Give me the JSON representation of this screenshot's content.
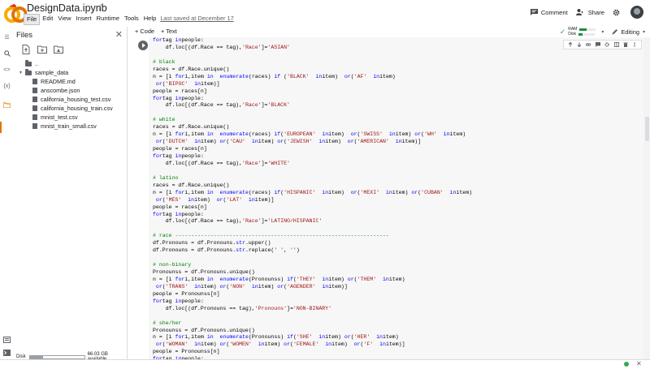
{
  "header": {
    "title": "DesignData.ipynb",
    "menu": [
      "File",
      "Edit",
      "View",
      "Insert",
      "Runtime",
      "Tools",
      "Help"
    ],
    "active_menu": "File",
    "last_saved": "Last saved at December 17",
    "comment_label": "Comment",
    "share_label": "Share"
  },
  "files_panel": {
    "title": "Files",
    "tree": [
      {
        "name": "..",
        "type": "folder",
        "indent": 0,
        "caret": ""
      },
      {
        "name": "sample_data",
        "type": "folder",
        "indent": 0,
        "caret": "▾"
      },
      {
        "name": "README.md",
        "type": "file",
        "indent": 1
      },
      {
        "name": "anscombe.json",
        "type": "file",
        "indent": 1
      },
      {
        "name": "california_housing_test.csv",
        "type": "file",
        "indent": 1
      },
      {
        "name": "california_housing_train.csv",
        "type": "file",
        "indent": 1
      },
      {
        "name": "mnist_test.csv",
        "type": "file",
        "indent": 1
      },
      {
        "name": "mnist_train_small.csv",
        "type": "file",
        "indent": 1
      }
    ],
    "disk_label": "Disk",
    "disk_available": "66.03 GB available",
    "disk_used_fraction": 0.24
  },
  "toolbar": {
    "add_code": "+ Code",
    "add_text": "+ Text",
    "ram_label": "RAM",
    "disk_label": "Disk",
    "ram_fraction": 0.45,
    "disk_fraction": 0.25,
    "editing_label": "Editing"
  },
  "code_lines": [
    [
      [
        "kw",
        "for"
      ],
      [
        "",
        "tag "
      ],
      [
        "kw",
        "in"
      ],
      [
        "",
        "people:"
      ]
    ],
    [
      [
        "",
        "    df.loc[(df.Race == tag),"
      ],
      [
        "st",
        "'Race'"
      ],
      [
        "",
        "]="
      ],
      [
        "st",
        "'ASIAN'"
      ]
    ],
    [
      [
        "",
        ""
      ]
    ],
    [
      [
        "cm",
        "# black"
      ]
    ],
    [
      [
        "",
        "races = df.Race.unique()"
      ]
    ],
    [
      [
        "",
        "n = [i "
      ],
      [
        "kw",
        "for"
      ],
      [
        "",
        "i,item "
      ],
      [
        "kw",
        "in"
      ],
      [
        "",
        ""
      ],
      [
        "kw",
        "enumerate"
      ],
      [
        "",
        "(races) "
      ],
      [
        "kw",
        "if"
      ],
      [
        "",
        ""
      ],
      [
        "",
        "("
      ],
      [
        "st",
        "'BLACK'"
      ],
      [
        "",
        ""
      ],
      [
        "kw",
        "in"
      ],
      [
        "",
        "item)  "
      ],
      [
        "kw",
        "or"
      ],
      [
        "",
        "("
      ],
      [
        "st",
        "'AF'"
      ],
      [
        "",
        ""
      ],
      [
        "kw",
        "in"
      ],
      [
        "",
        "item)"
      ]
    ],
    [
      [
        "",
        ""
      ],
      [
        "kw",
        "or"
      ],
      [
        "",
        "("
      ],
      [
        "st",
        "'BIPOC'"
      ],
      [
        "",
        ""
      ],
      [
        "kw",
        "in"
      ],
      [
        "",
        "item)]"
      ]
    ],
    [
      [
        "",
        "people = races[n]"
      ]
    ],
    [
      [
        "kw",
        "for"
      ],
      [
        "",
        "tag "
      ],
      [
        "kw",
        "in"
      ],
      [
        "",
        "people:"
      ]
    ],
    [
      [
        "",
        "    df.loc[(df.Race == tag),"
      ],
      [
        "st",
        "'Race'"
      ],
      [
        "",
        "]="
      ],
      [
        "st",
        "'BLACK'"
      ]
    ],
    [
      [
        "",
        ""
      ]
    ],
    [
      [
        "cm",
        "# white"
      ]
    ],
    [
      [
        "",
        "races = df.Race.unique()"
      ]
    ],
    [
      [
        "",
        "n = [i "
      ],
      [
        "kw",
        "for"
      ],
      [
        "",
        "i,item "
      ],
      [
        "kw",
        "in"
      ],
      [
        "",
        ""
      ],
      [
        "kw",
        "enumerate"
      ],
      [
        "",
        "(races) "
      ],
      [
        "kw",
        "if"
      ],
      [
        "",
        "("
      ],
      [
        "st",
        "'EUROPEAN'"
      ],
      [
        "",
        ""
      ],
      [
        "kw",
        "in"
      ],
      [
        "",
        "item)  "
      ],
      [
        "kw",
        "or"
      ],
      [
        "",
        "("
      ],
      [
        "st",
        "'SWISS'"
      ],
      [
        "",
        ""
      ],
      [
        "kw",
        "in"
      ],
      [
        "",
        "item) "
      ],
      [
        "kw",
        "or"
      ],
      [
        "",
        "("
      ],
      [
        "st",
        "'WH'"
      ],
      [
        "",
        ""
      ],
      [
        "kw",
        "in"
      ],
      [
        "",
        "item)"
      ]
    ],
    [
      [
        "",
        ""
      ],
      [
        "kw",
        "or"
      ],
      [
        "",
        "("
      ],
      [
        "st",
        "'DUTCH'"
      ],
      [
        "",
        ""
      ],
      [
        "kw",
        "in"
      ],
      [
        "",
        "item) "
      ],
      [
        "kw",
        "or"
      ],
      [
        "",
        "("
      ],
      [
        "st",
        "'CAU'"
      ],
      [
        "",
        ""
      ],
      [
        "kw",
        "in"
      ],
      [
        "",
        "item) "
      ],
      [
        "kw",
        "or"
      ],
      [
        "",
        "("
      ],
      [
        "st",
        "'JEWISH'"
      ],
      [
        "",
        ""
      ],
      [
        "kw",
        "in"
      ],
      [
        "",
        "item)  "
      ],
      [
        "kw",
        "or"
      ],
      [
        "",
        "("
      ],
      [
        "st",
        "'AMERICAN'"
      ],
      [
        "",
        ""
      ],
      [
        "kw",
        "in"
      ],
      [
        "",
        "item)]"
      ]
    ],
    [
      [
        "",
        "people = races[n]"
      ]
    ],
    [
      [
        "kw",
        "for"
      ],
      [
        "",
        "tag "
      ],
      [
        "kw",
        "in"
      ],
      [
        "",
        "people:"
      ]
    ],
    [
      [
        "",
        "    df.loc[(df.Race == tag),"
      ],
      [
        "st",
        "'Race'"
      ],
      [
        "",
        "]="
      ],
      [
        "st",
        "'WHITE'"
      ]
    ],
    [
      [
        "",
        ""
      ]
    ],
    [
      [
        "cm",
        "# latino"
      ]
    ],
    [
      [
        "",
        "races = df.Race.unique()"
      ]
    ],
    [
      [
        "",
        "n = [i "
      ],
      [
        "kw",
        "for"
      ],
      [
        "",
        "i,item "
      ],
      [
        "kw",
        "in"
      ],
      [
        "",
        ""
      ],
      [
        "kw",
        "enumerate"
      ],
      [
        "",
        "(races) "
      ],
      [
        "kw",
        "if"
      ],
      [
        "",
        "("
      ],
      [
        "st",
        "'HISPANIC'"
      ],
      [
        "",
        ""
      ],
      [
        "kw",
        "in"
      ],
      [
        "",
        "item)  "
      ],
      [
        "kw",
        "or"
      ],
      [
        "",
        "("
      ],
      [
        "st",
        "'MEXI'"
      ],
      [
        "",
        ""
      ],
      [
        "kw",
        "in"
      ],
      [
        "",
        "item) "
      ],
      [
        "kw",
        "or"
      ],
      [
        "",
        "("
      ],
      [
        "st",
        "'CUBAN'"
      ],
      [
        "",
        ""
      ],
      [
        "kw",
        "in"
      ],
      [
        "",
        "item)"
      ]
    ],
    [
      [
        "",
        ""
      ],
      [
        "kw",
        "or"
      ],
      [
        "",
        "("
      ],
      [
        "st",
        "'MES'"
      ],
      [
        "",
        ""
      ],
      [
        "kw",
        "in"
      ],
      [
        "",
        "item)  "
      ],
      [
        "kw",
        "or"
      ],
      [
        "",
        "("
      ],
      [
        "st",
        "'LAT'"
      ],
      [
        "",
        ""
      ],
      [
        "kw",
        "in"
      ],
      [
        "",
        "item)]"
      ]
    ],
    [
      [
        "",
        "people = races[n]"
      ]
    ],
    [
      [
        "kw",
        "for"
      ],
      [
        "",
        "tag "
      ],
      [
        "kw",
        "in"
      ],
      [
        "",
        "people:"
      ]
    ],
    [
      [
        "",
        "    df.loc[(df.Race == tag),"
      ],
      [
        "st",
        "'Race'"
      ],
      [
        "",
        "]="
      ],
      [
        "st",
        "'LATINO/HISPANIC'"
      ]
    ],
    [
      [
        "",
        ""
      ]
    ],
    [
      [
        "cm",
        "# race -------------------------------------------------------------------"
      ]
    ],
    [
      [
        "",
        "df.Pronouns = df.Pronouns."
      ],
      [
        "kw",
        "str"
      ],
      [
        "",
        ".upper()"
      ]
    ],
    [
      [
        "",
        "df.Pronouns = df.Pronouns."
      ],
      [
        "kw",
        "str"
      ],
      [
        "",
        ".replace("
      ],
      [
        "st",
        "' '"
      ],
      [
        "",
        ", "
      ],
      [
        "st",
        "''"
      ],
      [
        "",
        ")"
      ]
    ],
    [
      [
        "",
        ""
      ]
    ],
    [
      [
        "cm",
        "# non-binary"
      ]
    ],
    [
      [
        "",
        "Pronounss = df.Pronouns.unique()"
      ]
    ],
    [
      [
        "",
        "n = [i "
      ],
      [
        "kw",
        "for"
      ],
      [
        "",
        "i,item "
      ],
      [
        "kw",
        "in"
      ],
      [
        "",
        ""
      ],
      [
        "kw",
        "enumerate"
      ],
      [
        "",
        "(Pronounss) "
      ],
      [
        "kw",
        "if"
      ],
      [
        "",
        "("
      ],
      [
        "st",
        "'THEY'"
      ],
      [
        "",
        ""
      ],
      [
        "kw",
        "in"
      ],
      [
        "",
        "item) "
      ],
      [
        "kw",
        "or"
      ],
      [
        "",
        "("
      ],
      [
        "st",
        "'THEM'"
      ],
      [
        "",
        ""
      ],
      [
        "kw",
        "in"
      ],
      [
        "",
        "item)"
      ]
    ],
    [
      [
        "",
        ""
      ],
      [
        "kw",
        "or"
      ],
      [
        "",
        "("
      ],
      [
        "st",
        "'TRANS'"
      ],
      [
        "",
        ""
      ],
      [
        "kw",
        "in"
      ],
      [
        "",
        "item) "
      ],
      [
        "kw",
        "or"
      ],
      [
        "",
        "("
      ],
      [
        "st",
        "'NON'"
      ],
      [
        "",
        ""
      ],
      [
        "kw",
        "in"
      ],
      [
        "",
        "item) "
      ],
      [
        "kw",
        "or"
      ],
      [
        "",
        "("
      ],
      [
        "st",
        "'AGENDER'"
      ],
      [
        "",
        ""
      ],
      [
        "kw",
        "in"
      ],
      [
        "",
        "item)]"
      ]
    ],
    [
      [
        "",
        "people = Pronounss[n]"
      ]
    ],
    [
      [
        "kw",
        "for"
      ],
      [
        "",
        "tag "
      ],
      [
        "kw",
        "in"
      ],
      [
        "",
        "people:"
      ]
    ],
    [
      [
        "",
        "    df.loc[(df.Pronouns == tag),"
      ],
      [
        "st",
        "'Pronouns'"
      ],
      [
        "",
        "]="
      ],
      [
        "st",
        "'NON-BINARY'"
      ]
    ],
    [
      [
        "",
        ""
      ]
    ],
    [
      [
        "cm",
        "# she/her"
      ]
    ],
    [
      [
        "",
        "Pronounss = df.Pronouns.unique()"
      ]
    ],
    [
      [
        "",
        "n = [i "
      ],
      [
        "kw",
        "for"
      ],
      [
        "",
        "i,item "
      ],
      [
        "kw",
        "in"
      ],
      [
        "",
        ""
      ],
      [
        "kw",
        "enumerate"
      ],
      [
        "",
        "(Pronounss) "
      ],
      [
        "kw",
        "if"
      ],
      [
        "",
        "("
      ],
      [
        "st",
        "'SHE'"
      ],
      [
        "",
        ""
      ],
      [
        "kw",
        "in"
      ],
      [
        "",
        "item) "
      ],
      [
        "kw",
        "or"
      ],
      [
        "",
        "("
      ],
      [
        "st",
        "'HER'"
      ],
      [
        "",
        ""
      ],
      [
        "kw",
        "in"
      ],
      [
        "",
        "item)"
      ]
    ],
    [
      [
        "",
        ""
      ],
      [
        "kw",
        "or"
      ],
      [
        "",
        "("
      ],
      [
        "st",
        "'WOMAN'"
      ],
      [
        "",
        ""
      ],
      [
        "kw",
        "in"
      ],
      [
        "",
        "item) "
      ],
      [
        "kw",
        "or"
      ],
      [
        "",
        "("
      ],
      [
        "st",
        "'WOMEN'"
      ],
      [
        "",
        ""
      ],
      [
        "kw",
        "in"
      ],
      [
        "",
        "item) "
      ],
      [
        "kw",
        "or"
      ],
      [
        "",
        "("
      ],
      [
        "st",
        "'FEMALE'"
      ],
      [
        "",
        ""
      ],
      [
        "kw",
        "in"
      ],
      [
        "",
        "item)  "
      ],
      [
        "kw",
        "or"
      ],
      [
        "",
        "("
      ],
      [
        "st",
        "'F'"
      ],
      [
        "",
        ""
      ],
      [
        "kw",
        "in"
      ],
      [
        "",
        "item)]"
      ]
    ],
    [
      [
        "",
        "people = Pronounss[n]"
      ]
    ],
    [
      [
        "kw",
        "for"
      ],
      [
        "",
        "tag "
      ],
      [
        "kw",
        "in"
      ],
      [
        "",
        "people:"
      ]
    ]
  ],
  "colors": {
    "accent_orange": "#e37400",
    "comment_green": "#008000",
    "string_red": "#a31515",
    "keyword_blue": "#0000ff",
    "status_green": "#34a853"
  }
}
